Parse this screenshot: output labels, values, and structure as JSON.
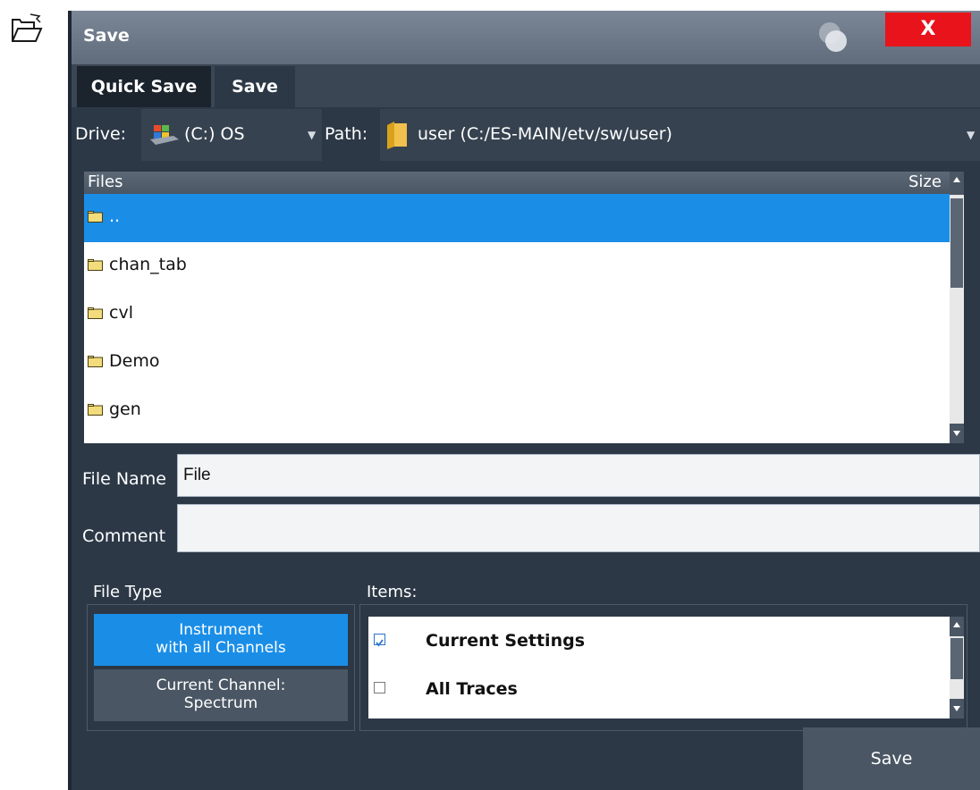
{
  "dialog": {
    "title": "Save",
    "close_label": "X"
  },
  "tabs": [
    {
      "label": "Quick Save"
    },
    {
      "label": "Save"
    }
  ],
  "drive": {
    "label": "Drive:",
    "value": "(C:) OS"
  },
  "path": {
    "label": "Path:",
    "value": "user (C:/ES-MAIN/etv/sw/user)"
  },
  "file_list": {
    "headers": {
      "files": "Files",
      "size": "Size"
    },
    "rows": [
      {
        "name": "..",
        "selected": true
      },
      {
        "name": "chan_tab"
      },
      {
        "name": "cvl"
      },
      {
        "name": "Demo"
      },
      {
        "name": "gen"
      }
    ]
  },
  "file_name": {
    "label": "File Name",
    "value": "File"
  },
  "comment": {
    "label": "Comment",
    "value": ""
  },
  "file_type": {
    "label": "File Type",
    "options": [
      {
        "line1": "Instrument",
        "line2": "with all Channels",
        "selected": true
      },
      {
        "line1": "Current Channel:",
        "line2": "Spectrum",
        "selected": false
      }
    ]
  },
  "items": {
    "label": "Items:",
    "entries": [
      {
        "label": "Current Settings",
        "checked": true
      },
      {
        "label": "All Traces",
        "checked": false
      }
    ]
  },
  "save_button": {
    "label": "Save"
  },
  "colors": {
    "accent": "#1a8ee7",
    "close": "#e8131b",
    "panel": "#2c3846",
    "button": "#4a5664"
  },
  "icons": [
    "open-folder-icon",
    "help-icon",
    "drive-icon",
    "folder-icon",
    "close-icon"
  ]
}
